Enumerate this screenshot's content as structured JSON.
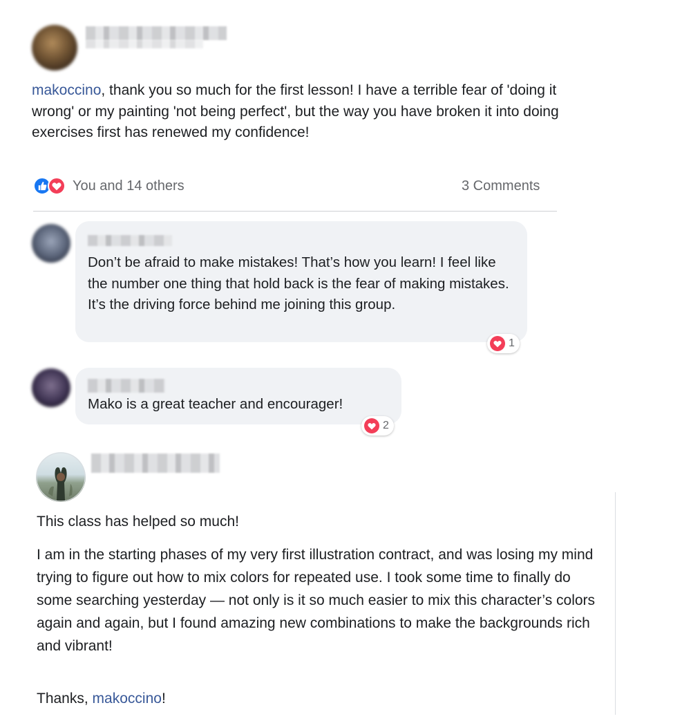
{
  "post": {
    "mention": "makoccino",
    "text": ", thank you so much for the first lesson! I have a terrible fear of 'doing it wrong' or my painting 'not being perfect', but the way you have broken it into doing exercises first has renewed my confidence!",
    "reactions_text": "You and 14 others",
    "comments_count": "3 Comments",
    "reaction_icons": [
      "like-icon",
      "heart-icon"
    ],
    "colors": {
      "like": "#1877f2",
      "love": "#f33e58",
      "mention": "#385898"
    }
  },
  "comments": [
    {
      "text": "Don’t be afraid to make mistakes! That’s how you learn! I feel like the number one thing that hold back is the fear of making mistakes. It’s the driving force behind me joining this group.",
      "reaction_count": "1"
    },
    {
      "text": "Mako is a great teacher and encourager!",
      "reaction_count": "2"
    }
  ],
  "second_post": {
    "para1": "This class has helped so much!",
    "para2": "I am in the starting phases of my very first illustration contract, and was losing my mind trying to figure out how to mix colors for repeated use. I took some time to finally do some searching yesterday — not only is it so much easier to mix this character’s colors again and again, but I found amazing new combinations to make the backgrounds rich and vibrant!",
    "thanks_prefix": "Thanks, ",
    "mention": "makoccino",
    "thanks_suffix": "!"
  }
}
